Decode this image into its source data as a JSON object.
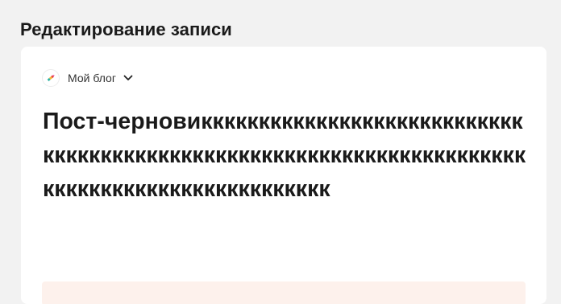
{
  "page": {
    "title": "Редактирование записи"
  },
  "editor": {
    "blog_selector": {
      "blog_name": "Мой блог",
      "logo_icon": "pencil-logo-icon",
      "dropdown_icon": "chevron-down-icon"
    },
    "post_title": "Пост-черновиккккккккккккккккккккккккккккккккккккккккккккккккккккккккккккккккккккккккккккккккккккккккккккккк"
  },
  "colors": {
    "page_background": "#f2f2f2",
    "card_background": "#ffffff",
    "text_primary": "#1a1a1a",
    "hint_background": "#fdf1ec"
  }
}
